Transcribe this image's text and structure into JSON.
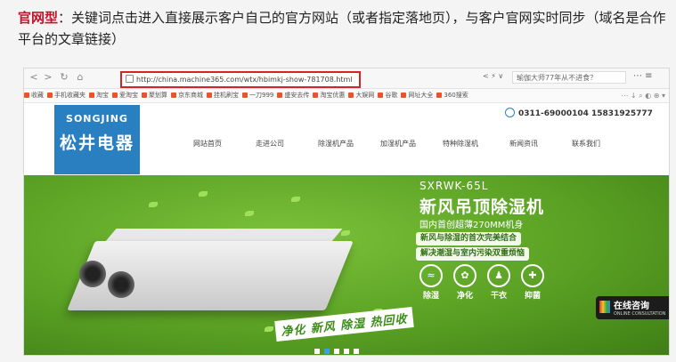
{
  "caption": {
    "bold": "官网型",
    "text": "：关键词点击进入直接展示客户自己的官方网站（或者指定落地页），与客户官网实时同步（域名是合作平台的文章链接）"
  },
  "browser": {
    "url": "http://china.machine365.com/wtx/hbimkj-show-781708.html",
    "search_placeholder": "瑜伽大师77年从不进食？",
    "nav_back": "<",
    "nav_forward": ">",
    "refresh": "↻",
    "home": "⌂",
    "addr_extra": "< ⚡ ∨",
    "tools": "⋯ ≡"
  },
  "bookmarks": [
    "收藏",
    "手机收藏夹",
    "淘宝",
    "爱淘宝",
    "聚划算",
    "京东商城",
    "挂机刷宝",
    "一刀999",
    "盛安去传",
    "淘宝优惠",
    "大娱网",
    "谷歌",
    "网址大全",
    "360搜索"
  ],
  "bookmarks_tools": "⋯ ↓ ⌕ ◐ ⊕ ▾",
  "site": {
    "logo_en": "SONGJING",
    "logo_zh": "松井电器",
    "phone": "0311-69000104 15831925777",
    "menu": [
      "网站首页",
      "走进公司",
      "除湿机产品",
      "加湿机产品",
      "特种除湿机",
      "新闻资讯",
      "联系我们"
    ]
  },
  "banner": {
    "model": "SXRWK-65L",
    "title": "新风吊顶除湿机",
    "subtitle": "国内首创超薄270MM机身",
    "pill1": "新风与除湿的首次完美结合",
    "pill2": "解决潮湿与室内污染双重烦恼",
    "features": [
      {
        "icon": "≈",
        "label": "除湿"
      },
      {
        "icon": "✿",
        "label": "净化"
      },
      {
        "icon": "♟",
        "label": "干衣"
      },
      {
        "icon": "✚",
        "label": "抑菌"
      }
    ],
    "slogan": "净化 新风 除湿 热回收",
    "consult_zh": "在线咨询",
    "consult_en": "ONLINE CONSULTATION",
    "slide_count": 5,
    "active_slide": 2
  }
}
